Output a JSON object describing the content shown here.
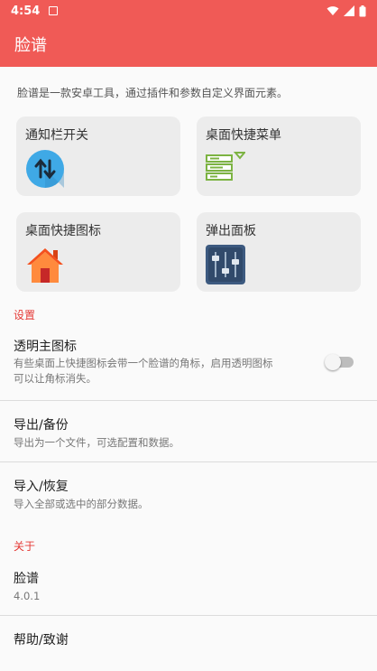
{
  "status_bar": {
    "time": "4:54"
  },
  "app_bar": {
    "title": "脸谱"
  },
  "description": "脸谱是一款安卓工具，通过插件和参数自定义界面元素。",
  "cards": [
    {
      "label": "通知栏开关",
      "icon": "updown-arrows-icon"
    },
    {
      "label": "桌面快捷菜单",
      "icon": "menu-list-icon"
    },
    {
      "label": "桌面快捷图标",
      "icon": "home-icon"
    },
    {
      "label": "弹出面板",
      "icon": "sliders-icon"
    }
  ],
  "settings": {
    "header": "设置",
    "transparent_icon": {
      "title": "透明主图标",
      "summary_line1": "有些桌面上快捷图标会带一个脸谱的角标，启用透明图标",
      "summary_line2": "可以让角标消失。",
      "enabled": false
    },
    "export": {
      "title": "导出/备份",
      "summary": "导出为一个文件，可选配置和数据。"
    },
    "import": {
      "title": "导入/恢复",
      "summary": "导入全部或选中的部分数据。"
    }
  },
  "about": {
    "header": "关于",
    "app": {
      "title": "脸谱",
      "version": "4.0.1"
    },
    "help": {
      "title": "帮助/致谢"
    }
  },
  "colors": {
    "accent": "#f05a56",
    "section_header": "#e53935",
    "card_bg": "#ececec"
  }
}
